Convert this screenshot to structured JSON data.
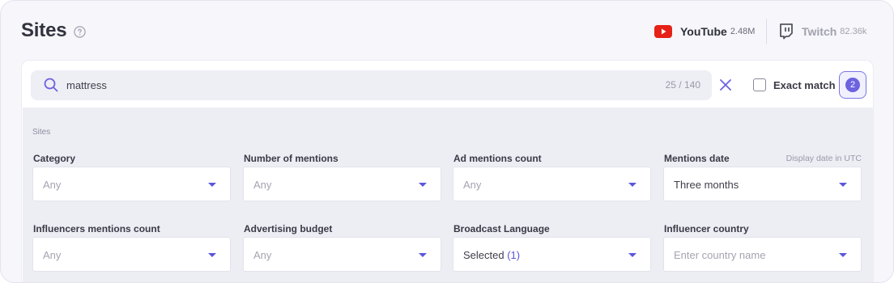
{
  "header": {
    "title": "Sites",
    "platforms": [
      {
        "name": "YouTube",
        "count": "2.48M"
      },
      {
        "name": "Twitch",
        "count": "82.36k"
      }
    ]
  },
  "search": {
    "value": "mattress",
    "counter": "25 / 140",
    "exact_match_label": "Exact match",
    "exact_match_checked": false,
    "active_filters": "2"
  },
  "filters": {
    "section_label": "Sites",
    "rows": [
      [
        {
          "label": "Category",
          "value": "Any",
          "placeholder": true
        },
        {
          "label": "Number of mentions",
          "value": "Any",
          "placeholder": true
        },
        {
          "label": "Ad mentions count",
          "value": "Any",
          "placeholder": true
        },
        {
          "label": "Mentions date",
          "note": "Display date in UTC",
          "value": "Three months",
          "placeholder": false
        }
      ],
      [
        {
          "label": "Influencers mentions count",
          "value": "Any",
          "placeholder": true
        },
        {
          "label": "Advertising budget",
          "value": "Any",
          "placeholder": true
        },
        {
          "label": "Broadcast Language",
          "value": "Selected",
          "accent": "(1)",
          "placeholder": false
        },
        {
          "label": "Influencer country",
          "value": "Enter country name",
          "placeholder": true
        }
      ]
    ]
  },
  "colors": {
    "accent": "#6c63e0",
    "youtube_red": "#e62117",
    "background": "#f6f6fb"
  },
  "icons": [
    "help-icon",
    "youtube-icon",
    "twitch-icon",
    "search-icon",
    "clear-icon",
    "chevron-down-icon"
  ]
}
